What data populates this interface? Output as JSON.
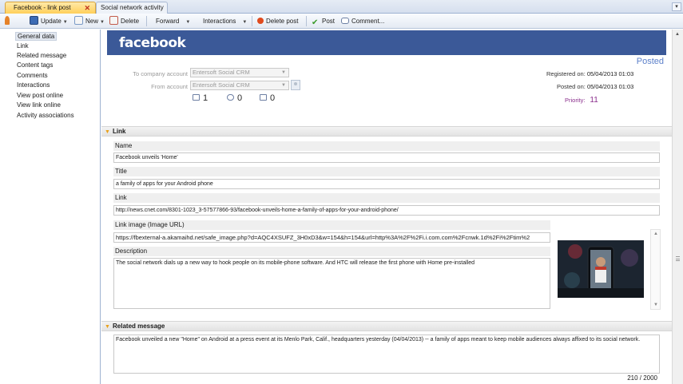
{
  "tabs": {
    "active": "Facebook - link post",
    "close_glyph": "✕",
    "second": "Social network activity",
    "menu_glyph": "▾"
  },
  "toolbar": {
    "update": "Update",
    "new": "New",
    "delete": "Delete",
    "forward": "Forward",
    "interactions": "Interactions",
    "delete_post": "Delete post",
    "post": "Post",
    "comment": "Comment..."
  },
  "nav": [
    "General data",
    "Link",
    "Related message",
    "Content tags",
    "Comments",
    "Interactions",
    "View post online",
    "View link online",
    "Activity associations"
  ],
  "header": {
    "logo": "facebook",
    "status": "Posted",
    "to_label": "To company account",
    "to_value": "Entersoft Social CRM",
    "from_label": "From account",
    "from_value": "Entersoft Social CRM",
    "likes": "1",
    "comments": "0",
    "shares": "0",
    "registered_label": "Registered on:",
    "registered_value": "05/04/2013 01:03",
    "posted_label": "Posted on:",
    "posted_value": "05/04/2013 01:03",
    "priority_label": "Priority:",
    "priority_value": "11"
  },
  "link_section": {
    "title": "Link",
    "name_label": "Name",
    "name_value": "Facebook unveils 'Home'",
    "title_label": "Title",
    "title_value": "a family of apps for your Android phone",
    "link_label": "Link",
    "link_value": "http://news.cnet.com/8301-1023_3-57577866-93/facebook-unveils-home-a-family-of-apps-for-your-android-phone/",
    "image_label": "Link image (Image URL)",
    "image_value": "https://fbexternal-a.akamaihd.net/safe_image.php?d=AQC4XSUFZ_3H0xD3&w=154&h=154&url=http%3A%2F%2Fi.i.com.com%2Fcnwk.1d%2Fi%2Ftim%2",
    "description_label": "Description",
    "description_value": "The social network dials up a new way to hook people on its mobile-phone software. And HTC will release the first phone with Home pre-installed"
  },
  "related_section": {
    "title": "Related message",
    "text": "Facebook unveiled a new \"Home\" on Android at a press event at its Menlo Park, Calif., headquarters yesterday (04/04/2013) -- a family of apps meant to keep mobile audiences always affixed to its social network.",
    "char_count": "210  / 2000"
  },
  "colors": {
    "facebook_blue": "#3b5998",
    "posted_blue": "#5b7fc9",
    "priority_purple": "#8a2e8c",
    "active_tab": "#ffcf5a"
  }
}
